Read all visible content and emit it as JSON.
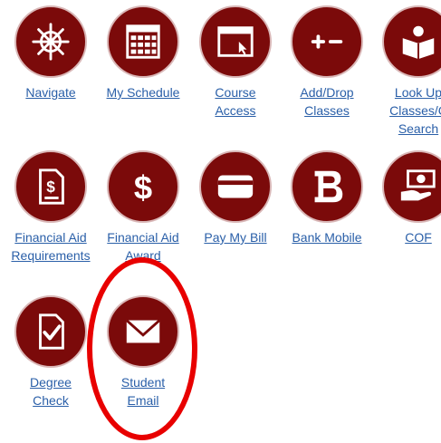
{
  "theme": {
    "circle_color": "#7b0a0a",
    "link_color": "#2a5fa8",
    "highlight_color": "#e80000"
  },
  "tiles": [
    {
      "icon": "ship-wheel-icon",
      "label_lines": [
        "Navigate"
      ]
    },
    {
      "icon": "calendar-icon",
      "label_lines": [
        "My Schedule"
      ]
    },
    {
      "icon": "browser-window-icon",
      "label_lines": [
        "Course",
        "Access"
      ]
    },
    {
      "icon": "plus-minus-icon",
      "label_lines": [
        "Add/Drop",
        "Classes"
      ]
    },
    {
      "icon": "book-reader-icon",
      "label_lines": [
        "Look Up",
        "Classes/C",
        "Search"
      ]
    },
    {
      "icon": "dollar-document-icon",
      "label_lines": [
        "Financial Aid",
        "Requirements"
      ]
    },
    {
      "icon": "dollar-sign-icon",
      "label_lines": [
        "Financial Aid",
        "Award"
      ]
    },
    {
      "icon": "credit-card-icon",
      "label_lines": [
        "Pay My Bill"
      ]
    },
    {
      "icon": "bank-mobile-b-icon",
      "label_lines": [
        "Bank Mobile"
      ]
    },
    {
      "icon": "money-hand-icon",
      "label_lines": [
        "COF"
      ]
    },
    {
      "icon": "check-document-icon",
      "label_lines": [
        "Degree",
        "Check"
      ]
    },
    {
      "icon": "envelope-icon",
      "label_lines": [
        "Student",
        "Email"
      ]
    }
  ],
  "highlight": {
    "target": "Student Email"
  }
}
